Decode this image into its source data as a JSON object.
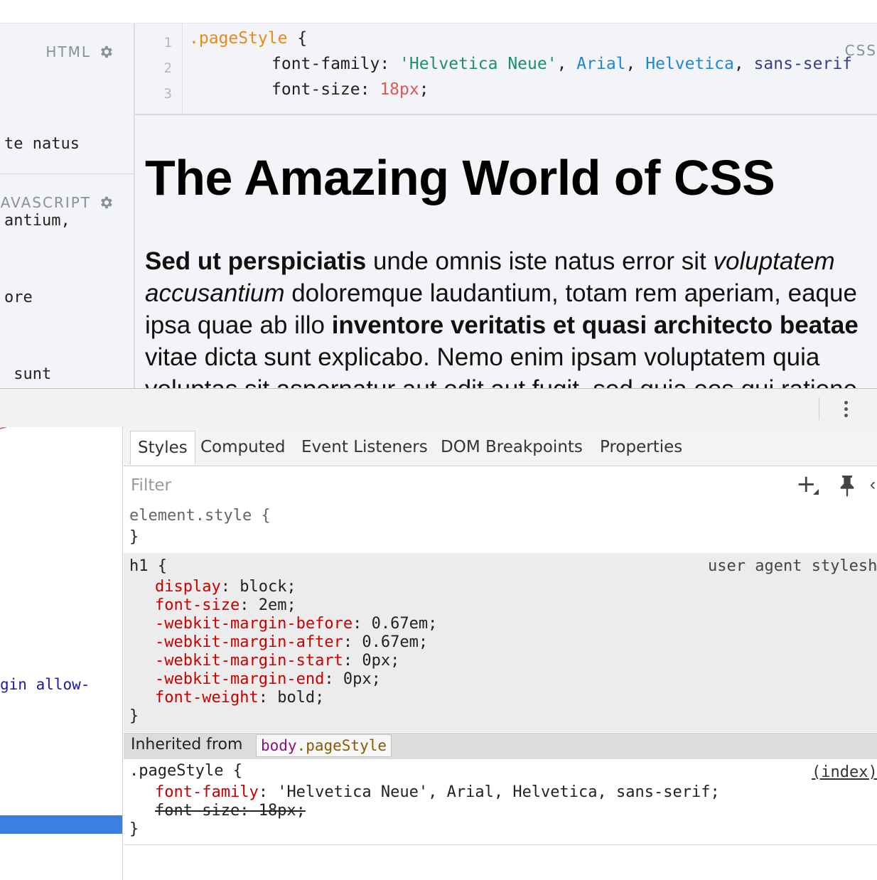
{
  "html_pane": {
    "header": "HTML",
    "lines": [
      "te natus",
      "antium,",
      "ore",
      " sunt"
    ],
    "js_header": "AVASCRIPT"
  },
  "css_editor": {
    "label": "CSS",
    "line_numbers": [
      "1",
      "2",
      "3"
    ],
    "selector": ".pageStyle",
    "open_brace": " {",
    "line2_prop": "font-family: ",
    "line2_val1": "'Helvetica Neue'",
    "line2_sep1": ", ",
    "line2_val2": "Arial",
    "line2_sep2": ", ",
    "line2_val3": "Helvetica",
    "line2_sep3": ", ",
    "line2_val4": "sans-serif",
    "line3_prop": "font-size: ",
    "line3_val": "18px",
    "line3_end": ";"
  },
  "preview": {
    "title": "The Amazing World of CSS",
    "p_l1_bold": "Sed ut perspiciatis",
    "p_l1_text": " unde omnis iste natus error sit ",
    "p_l1_ital": "voluptatem",
    "p_l2_ital": "accusantium",
    "p_l2_text": " doloremque laudantium, totam rem aperiam, eaque",
    "p_l3_text": "ipsa quae ab illo ",
    "p_l3_bold": "inventore veritatis et quasi architecto beatae",
    "p_l4_text": "vitae dicta sunt explicabo. Nemo enim ipsam voluptatem quia",
    "p_l5_text": "voluptas sit aspernatur aut odit aut fugit, sed quia eos qui ratione"
  },
  "elements": {
    "fragment": "gin allow-"
  },
  "styles": {
    "tabs": [
      "Styles",
      "Computed",
      "Event Listeners",
      "DOM Breakpoints",
      "Properties"
    ],
    "filter_placeholder": "Filter",
    "element_style_open": "element.style {",
    "close_brace": "}",
    "h1_open": "h1 {",
    "h1_source": "user agent stylesh",
    "h1_props": [
      {
        "name": "display",
        "value": ": block;"
      },
      {
        "name": "font-size",
        "value": ": 2em;"
      },
      {
        "name": "-webkit-margin-before",
        "value": ": 0.67em;"
      },
      {
        "name": "-webkit-margin-after",
        "value": ": 0.67em;"
      },
      {
        "name": "-webkit-margin-start",
        "value": ": 0px;"
      },
      {
        "name": "-webkit-margin-end",
        "value": ": 0px;"
      },
      {
        "name": "font-weight",
        "value": ": bold;"
      }
    ],
    "inherited_label": "Inherited from",
    "inherited_tag": "body",
    "inherited_class": ".pageStyle",
    "page_open": ".pageStyle {",
    "page_source": "(index)",
    "page_prop1_name": "font-family",
    "page_prop1_value": ": 'Helvetica Neue', Arial, Helvetica, sans-serif;",
    "page_prop2": "font-size: 18px;"
  },
  "colors": {
    "selection": "#3c7fe0",
    "property_name": "#c80000",
    "css_selector": "#e8891b",
    "css_string": "#1c8f6d",
    "css_keyword": "#1f86d6"
  },
  "icons": [
    "gear-icon",
    "plus-icon",
    "pin-icon",
    "more-vert-icon"
  ]
}
